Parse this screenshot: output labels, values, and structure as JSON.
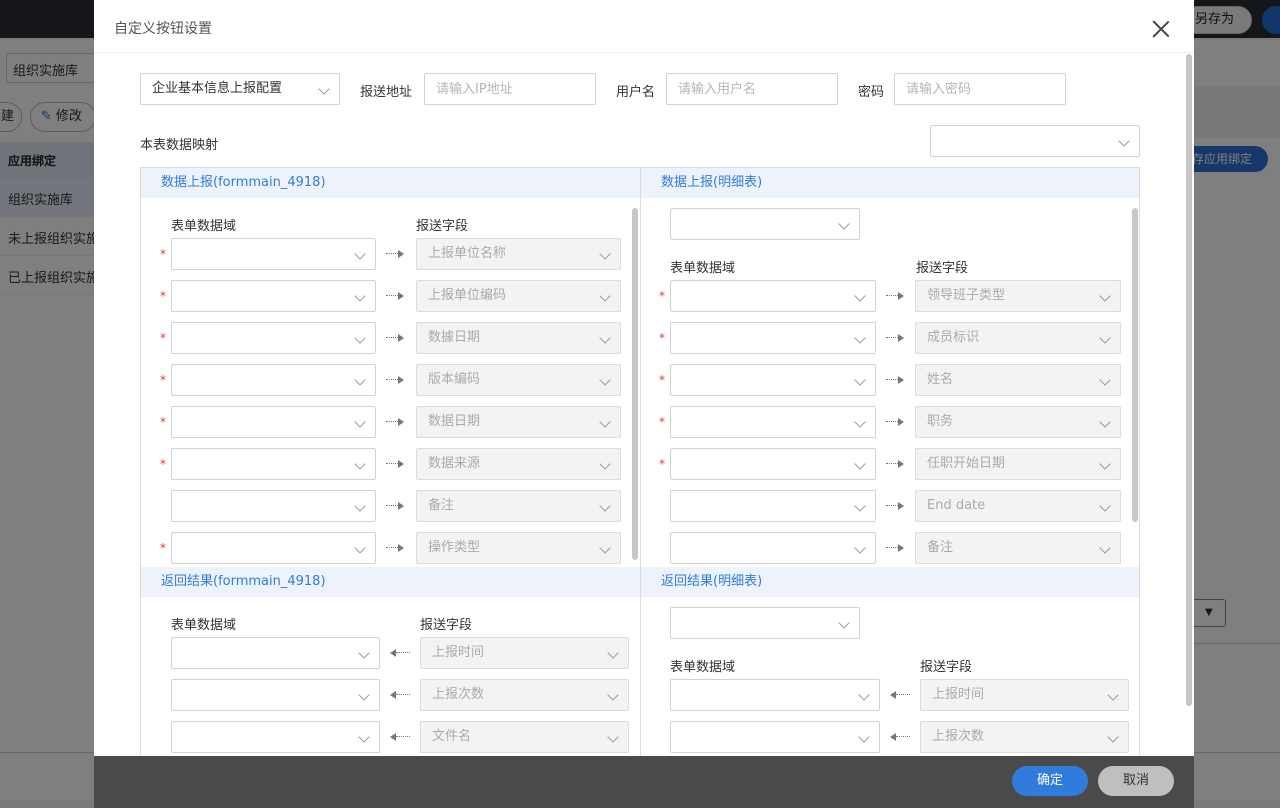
{
  "background": {
    "topbar_button": "另存为",
    "tab_select": "组织实施库",
    "toolbar_left_button": "建",
    "toolbar_edit_button": "修改",
    "list_header": "应用绑定",
    "list_items": [
      "组织实施库",
      "未上报组织实施",
      "已上报组织实施"
    ],
    "right_button": "存应用绑定"
  },
  "dialog": {
    "title": "自定义按钮设置",
    "config_select": "企业基本信息上报配置",
    "address_label": "报送地址",
    "address_placeholder": "请输入IP地址",
    "username_label": "用户名",
    "username_placeholder": "请输入用户名",
    "password_label": "密码",
    "password_placeholder": "请输入密码",
    "mapping_label": "本表数据映射",
    "mapping_select": "",
    "ok_label": "确定",
    "cancel_label": "取消"
  },
  "upload_main": {
    "title": "数据上报(formmain_4918)",
    "col_form": "表单数据域",
    "col_field": "报送字段",
    "rows": [
      {
        "required": true,
        "field": "上报单位名称"
      },
      {
        "required": true,
        "field": "上报单位编码"
      },
      {
        "required": true,
        "field": "数據日期"
      },
      {
        "required": true,
        "field": "版本编码"
      },
      {
        "required": true,
        "field": "数据日期"
      },
      {
        "required": true,
        "field": "数据来源"
      },
      {
        "required": false,
        "field": "备注"
      },
      {
        "required": true,
        "field": "操作类型"
      }
    ]
  },
  "upload_detail": {
    "title": "数据上报(明细表)",
    "table_select": "",
    "col_form": "表单数据域",
    "col_field": "报送字段",
    "rows": [
      {
        "required": true,
        "field": "领导班子类型"
      },
      {
        "required": true,
        "field": "成员标识"
      },
      {
        "required": true,
        "field": "姓名"
      },
      {
        "required": true,
        "field": "职务"
      },
      {
        "required": true,
        "field": "任职开始日期"
      },
      {
        "required": false,
        "field": "End date"
      },
      {
        "required": false,
        "field": "备注"
      }
    ]
  },
  "return_main": {
    "title": "返回结果(formmain_4918)",
    "col_form": "表单数据域",
    "col_field": "报送字段",
    "rows": [
      {
        "field": "上报时间"
      },
      {
        "field": "上报次数"
      },
      {
        "field": "文件名"
      }
    ]
  },
  "return_detail": {
    "title": "返回结果(明细表)",
    "table_select": "",
    "col_form": "表单数据域",
    "col_field": "报送字段",
    "rows": [
      {
        "field": "上报时间"
      },
      {
        "field": "上报次数"
      }
    ]
  }
}
